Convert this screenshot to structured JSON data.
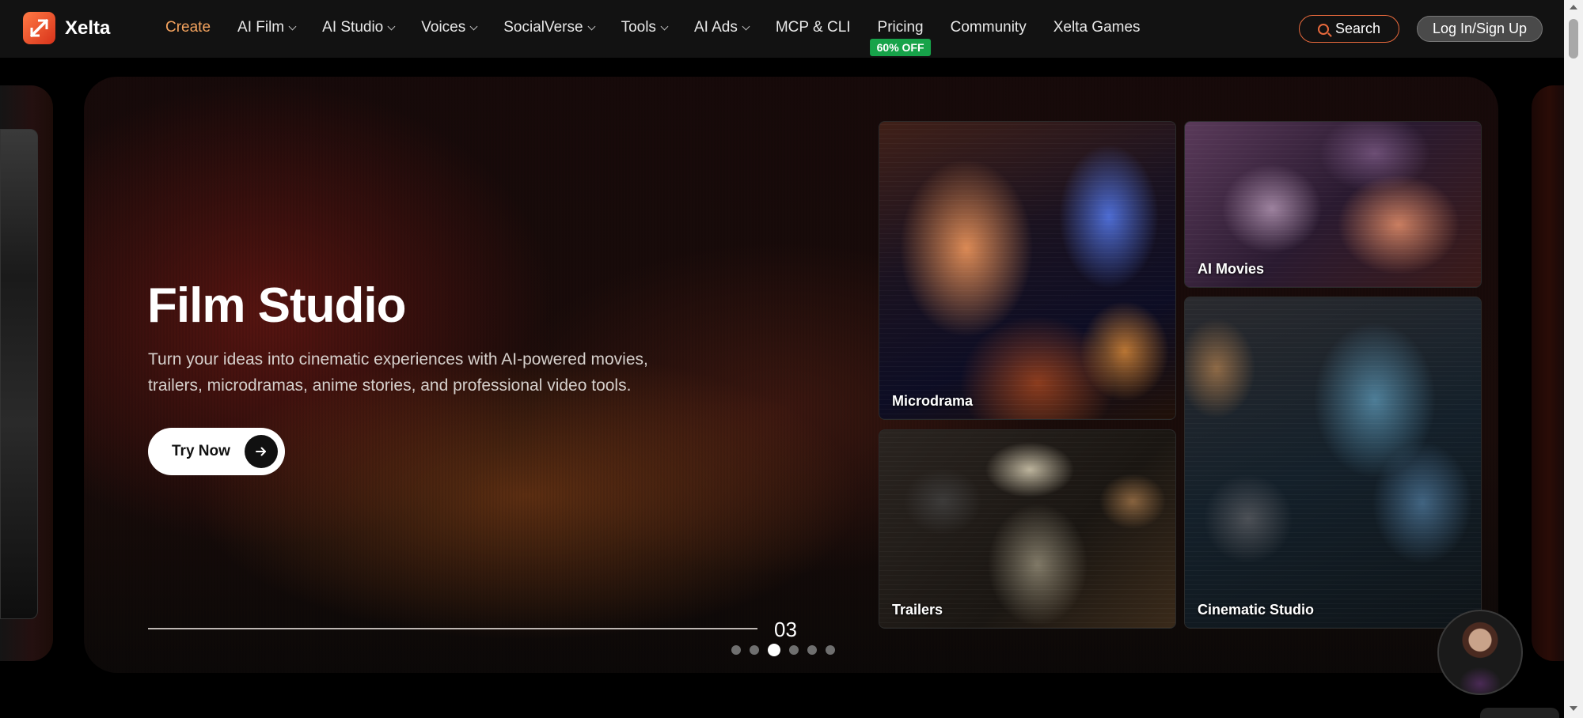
{
  "brand": {
    "name": "Xelta",
    "accent": "#f06b3a"
  },
  "nav": {
    "items": [
      {
        "label": "Create",
        "active": true,
        "dropdown": false
      },
      {
        "label": "AI Film",
        "dropdown": true
      },
      {
        "label": "AI Studio",
        "dropdown": true
      },
      {
        "label": "Voices",
        "dropdown": true
      },
      {
        "label": "SocialVerse",
        "dropdown": true
      },
      {
        "label": "Tools",
        "dropdown": true
      },
      {
        "label": "AI Ads",
        "dropdown": true
      },
      {
        "label": "MCP & CLI",
        "dropdown": false
      },
      {
        "label": "Pricing",
        "dropdown": false,
        "badge": "60% OFF"
      },
      {
        "label": "Community",
        "dropdown": false
      },
      {
        "label": "Xelta Games",
        "dropdown": false
      }
    ],
    "search_label": "Search",
    "login_label": "Log In/Sign Up"
  },
  "hero": {
    "title": "Film Studio",
    "description": "Turn your ideas into cinematic experiences with AI-powered movies, trailers, microdramas, anime stories, and professional video tools.",
    "cta_label": "Try Now",
    "slide_number": "03",
    "total_slides": 6,
    "active_slide": 3
  },
  "tiles": {
    "microdrama": "Microdrama",
    "ai_movies": "AI Movies",
    "trailers": "Trailers",
    "cinematic_studio": "Cinematic Studio"
  },
  "colors": {
    "active_nav": "#f4a35e",
    "badge": "#17a34a",
    "search_border": "#e8693c"
  },
  "icons": {
    "logo": "xelta-logo-icon",
    "search": "search-icon",
    "arrow": "arrow-right-icon",
    "chevron": "chevron-down-icon"
  }
}
